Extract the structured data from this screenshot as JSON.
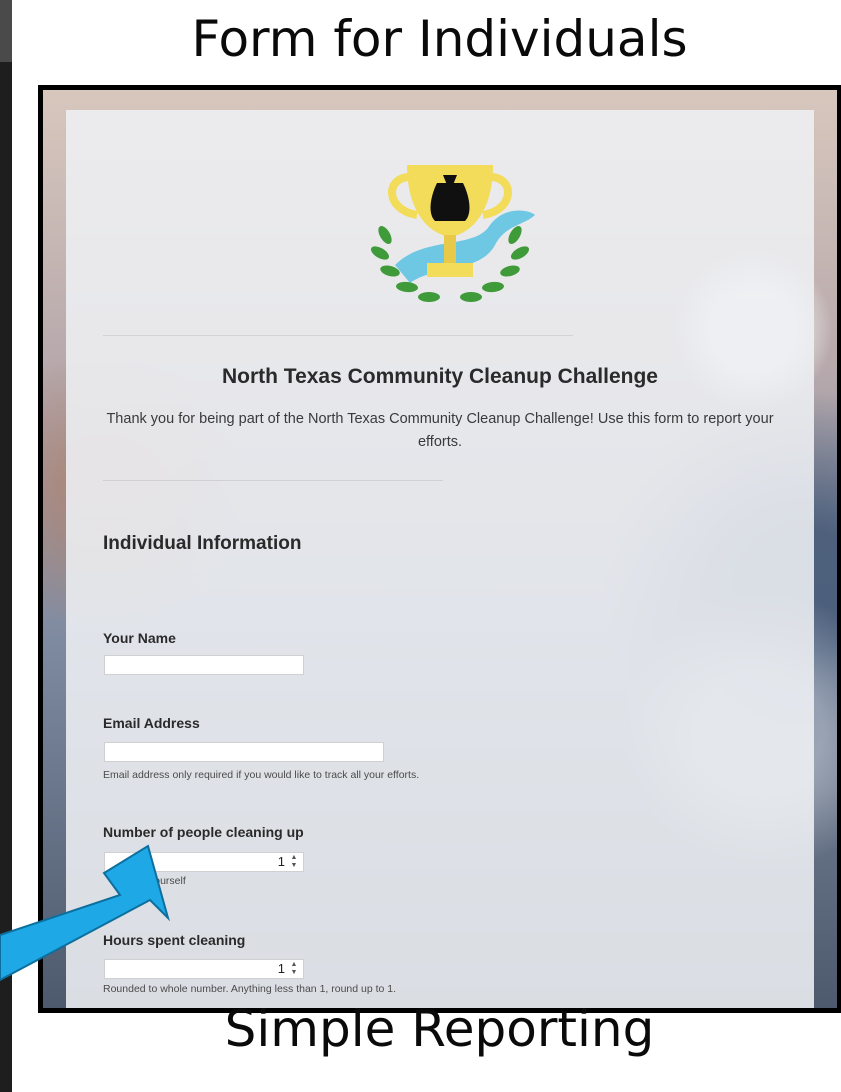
{
  "slide": {
    "title": "Form for Individuals",
    "caption": "Simple Reporting"
  },
  "form": {
    "title": "North Texas Community Cleanup Challenge",
    "description": "Thank you for being part of the North Texas Community Cleanup Challenge! Use this form to report your efforts.",
    "section_title": "Individual Information",
    "fields": {
      "name": {
        "label": "Your Name",
        "value": ""
      },
      "email": {
        "label": "Email Address",
        "value": "",
        "help": "Email address only required if you would like to track all your efforts."
      },
      "people": {
        "label": "Number of people cleaning up",
        "value": "1",
        "help_visible": "yourself"
      },
      "hours": {
        "label": "Hours spent cleaning",
        "value": "1",
        "help": "Rounded to whole number. Anything less than 1, round up to 1."
      }
    }
  },
  "colors": {
    "arrow": "#1ea8e6",
    "trophy_gold": "#f2dc5a",
    "laurel_green": "#3f9a3a",
    "river_blue": "#6ec8e4"
  },
  "icons": {
    "logo": "trophy-trash-bag-icon",
    "arrow": "pointer-arrow-icon",
    "spinner": "spinner-arrows-icon"
  }
}
